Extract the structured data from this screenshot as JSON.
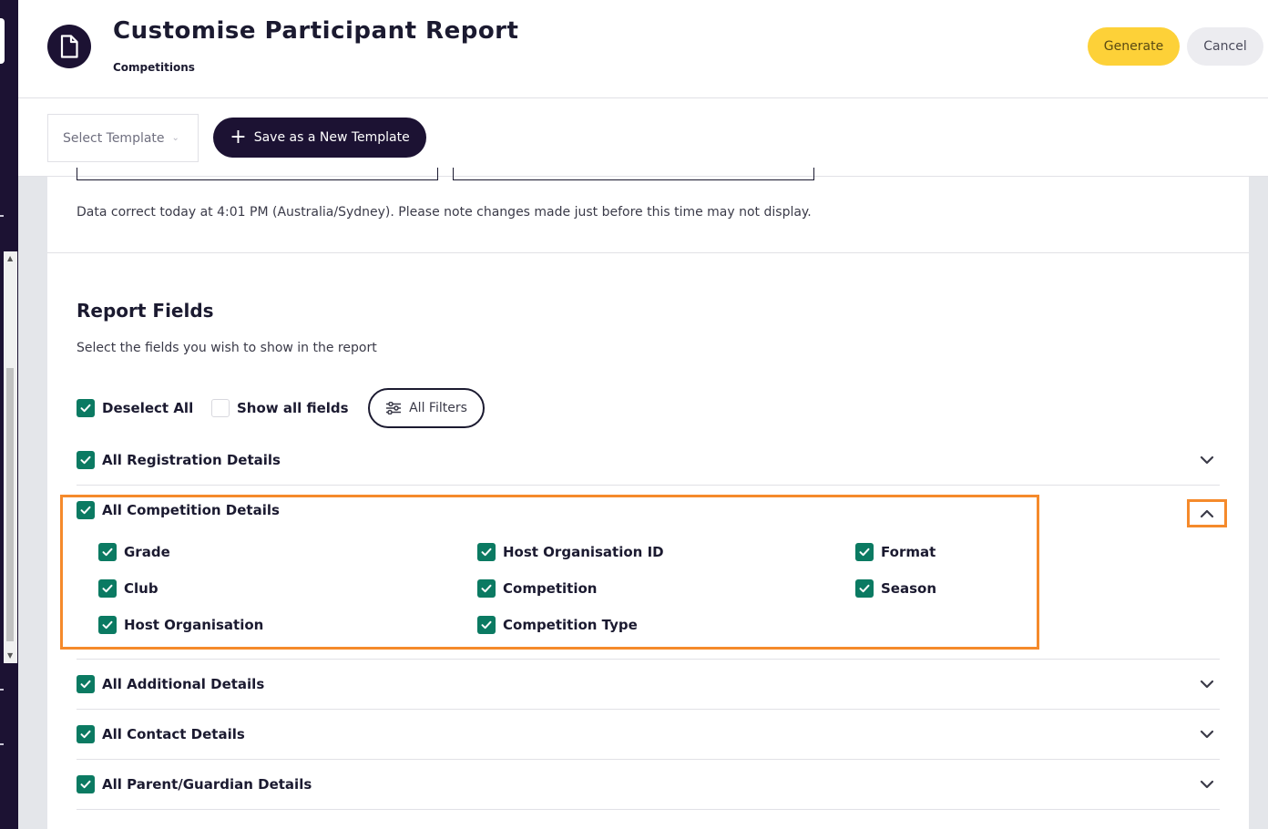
{
  "header": {
    "title": "Customise Participant Report",
    "subtitle": "Competitions",
    "generate_label": "Generate",
    "cancel_label": "Cancel"
  },
  "toolbar": {
    "template_placeholder": "Select Template",
    "save_template_label": "Save as a New Template"
  },
  "main": {
    "data_note": "Data correct today at 4:01 PM (Australia/Sydney). Please note changes made just before this time may not display.",
    "section_title": "Report Fields",
    "section_subtitle": "Select the fields you wish to show in the report",
    "deselect_all_label": "Deselect All",
    "show_all_fields_label": "Show all fields",
    "all_filters_label": "All Filters",
    "groups": [
      {
        "label": "All Registration Details",
        "checked": true,
        "expanded": false
      },
      {
        "label": "All Competition Details",
        "checked": true,
        "expanded": true
      },
      {
        "label": "All Additional Details",
        "checked": true,
        "expanded": false
      },
      {
        "label": "All Contact Details",
        "checked": true,
        "expanded": false
      },
      {
        "label": "All Parent/Guardian Details",
        "checked": true,
        "expanded": false
      }
    ],
    "competition_fields": [
      {
        "label": "Grade",
        "checked": true
      },
      {
        "label": "Host Organisation ID",
        "checked": true
      },
      {
        "label": "Format",
        "checked": true
      },
      {
        "label": "Club",
        "checked": true
      },
      {
        "label": "Competition",
        "checked": true
      },
      {
        "label": "Season",
        "checked": true
      },
      {
        "label": "Host Organisation",
        "checked": true
      },
      {
        "label": "Competition Type",
        "checked": true
      }
    ]
  },
  "colors": {
    "primary_dark": "#1c1233",
    "accent_yellow": "#fdd138",
    "checkbox_green": "#0b7a62",
    "highlight_orange": "#f58a2b"
  }
}
